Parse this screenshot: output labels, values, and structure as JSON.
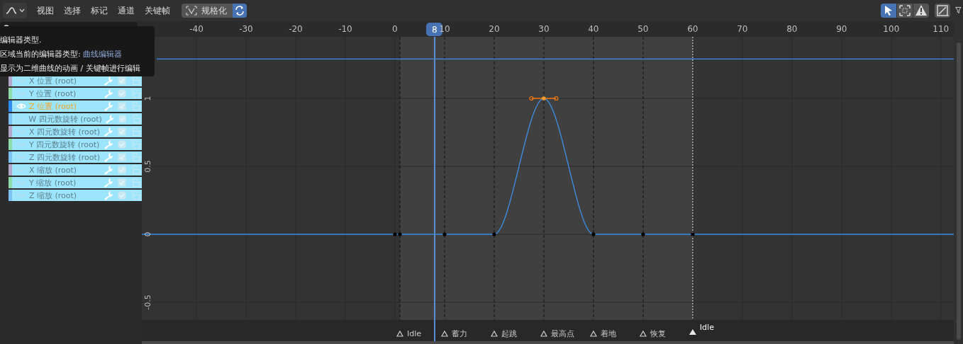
{
  "header": {
    "editor_type": {
      "kind": "graph"
    },
    "menus": [
      "视图",
      "选择",
      "标记",
      "通道",
      "关键帧"
    ],
    "normalize": {
      "label": "规格化",
      "on": false
    },
    "auto_sync": {
      "on": true
    },
    "tools": [
      {
        "kind": "select",
        "selected": true
      },
      {
        "kind": "box",
        "selected": false
      },
      {
        "kind": "warning",
        "selected": false
      }
    ],
    "extra_tools": [
      {
        "kind": "crop"
      },
      {
        "kind": "filter"
      }
    ]
  },
  "tooltip": {
    "title": "编辑器类型.",
    "description_label": "区域当前的编辑器类型: ",
    "description_value": "曲线编辑器",
    "detail": "显示为二维曲线的动画 / 关键帧进行编辑"
  },
  "channels": [
    {
      "name": "X 位置 (root)",
      "color": "#b5a8cc",
      "selected": false
    },
    {
      "name": "Y 位置 (root)",
      "color": "#8fdca8",
      "selected": false
    },
    {
      "name": "Z 位置 (root)",
      "color": "#2f8cf5",
      "selected": true
    },
    {
      "name": "W 四元数旋转 (root)",
      "color": "#7cc2f5",
      "selected": false
    },
    {
      "name": "X 四元数旋转 (root)",
      "color": "#b5a8cc",
      "selected": false
    },
    {
      "name": "Y 四元数旋转 (root)",
      "color": "#8fdca8",
      "selected": false
    },
    {
      "name": "Z 四元数旋转 (root)",
      "color": "#7cc2f5",
      "selected": false
    },
    {
      "name": "X 缩放 (root)",
      "color": "#b5a8cc",
      "selected": false
    },
    {
      "name": "Y 缩放 (root)",
      "color": "#8fdca8",
      "selected": false
    },
    {
      "name": "Z 缩放 (root)",
      "color": "#7cc2f5",
      "selected": false
    }
  ],
  "graph": {
    "keyframes": [
      {
        "kind": "extension"
      },
      {
        "kind": "extension"
      },
      {
        "kind": "key",
        "selected": false
      },
      {
        "kind": "key",
        "selected": false
      },
      {
        "kind": "key",
        "selected": false
      },
      {
        "kind": "key",
        "selected": false
      },
      {
        "kind": "key",
        "selected": true
      },
      {
        "kind": "key",
        "selected": false
      },
      {
        "kind": "key",
        "selected": false
      },
      {
        "kind": "key",
        "selected": false
      },
      {
        "kind": "extension"
      }
    ],
    "overlays": [
      {
        "kind": "playhead"
      },
      {
        "kind": "marker",
        "selected": false
      },
      {
        "kind": "marker",
        "selected": false
      },
      {
        "kind": "marker",
        "selected": false
      },
      {
        "kind": "marker",
        "selected": false
      },
      {
        "kind": "marker",
        "selected": false
      },
      {
        "kind": "marker",
        "selected": false
      },
      {
        "kind": "marker",
        "selected": true
      }
    ],
    "chart_data": {
      "type": "line",
      "grid": true,
      "x": [
        -51,
        -48,
        0,
        1,
        10,
        20,
        30,
        40,
        50,
        60,
        112.6
      ],
      "xlim": [
        -51,
        112.6
      ],
      "ylim": [
        -0.63,
        1.453
      ],
      "xticks": [
        -40,
        -30,
        -20,
        -10,
        0,
        10,
        20,
        30,
        40,
        50,
        60,
        70,
        80,
        90,
        100,
        110
      ],
      "yticks": [
        -0.5,
        0,
        0.5,
        1
      ],
      "bands": [
        {
          "axis": "x",
          "from": 1,
          "to": 60
        }
      ],
      "series": [
        {
          "color": "#3d8ee6",
          "values": [
            0,
            0,
            0,
            0,
            0,
            0,
            1,
            0,
            0,
            0,
            0
          ]
        },
        {
          "color": "#3d8ee6",
          "values": [
            null,
            1.29,
            1.29,
            1.29,
            1.29,
            1.29,
            1.29,
            1.29,
            1.29,
            1.29,
            1.29
          ]
        }
      ],
      "ref_lines": [
        {
          "axis": "x",
          "value": 8,
          "label": "8"
        },
        {
          "axis": "x",
          "value": 1,
          "label": "Idle"
        },
        {
          "axis": "x",
          "value": 10,
          "label": "蓄力"
        },
        {
          "axis": "x",
          "value": 20,
          "label": "起跳"
        },
        {
          "axis": "x",
          "value": 30,
          "label": "最高点"
        },
        {
          "axis": "x",
          "value": 40,
          "label": "着地"
        },
        {
          "axis": "x",
          "value": 50,
          "label": "恢复"
        },
        {
          "axis": "x",
          "value": 60,
          "label": "Idle"
        }
      ]
    }
  }
}
